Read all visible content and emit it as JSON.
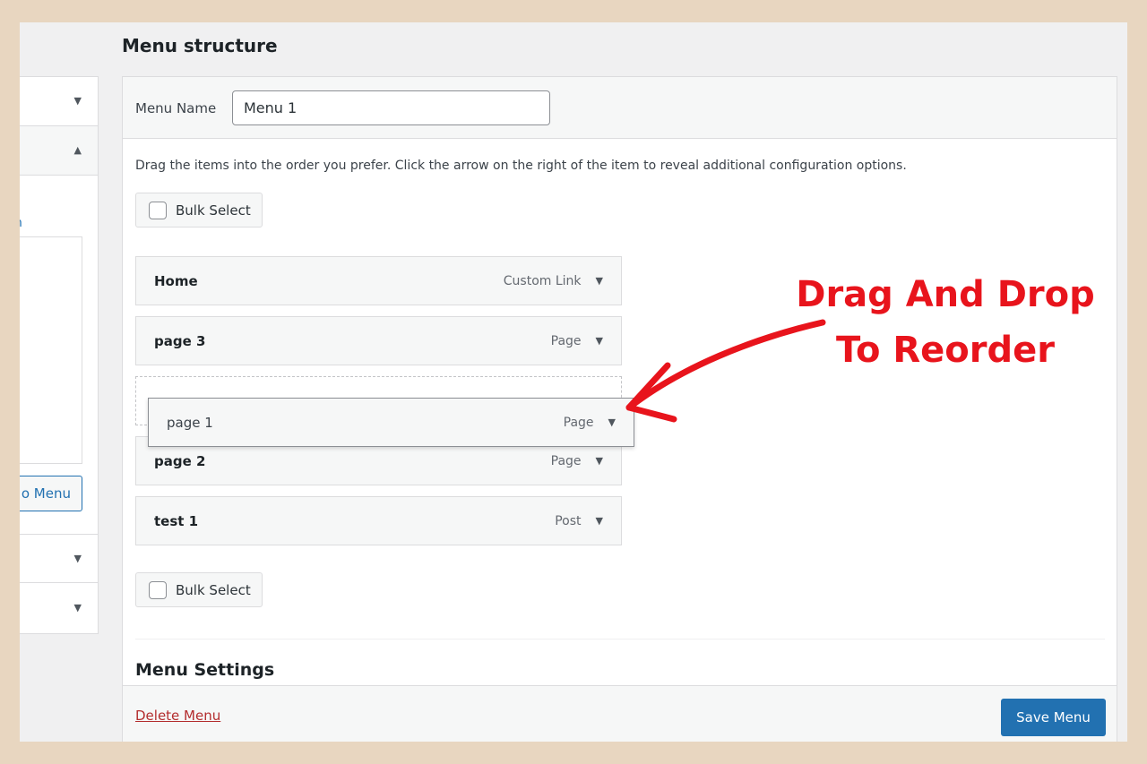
{
  "section_title": "Menu structure",
  "left_panel": {
    "link_fragment": "n",
    "add_button": "o Menu"
  },
  "menu_name": {
    "label": "Menu Name",
    "value": "Menu 1"
  },
  "instructions": "Drag the items into the order you prefer. Click the arrow on the right of the item to reveal additional configuration options.",
  "bulk_select": "Bulk Select",
  "items": [
    {
      "title": "Home",
      "type": "Custom Link"
    },
    {
      "title": "page 3",
      "type": "Page"
    },
    {
      "title": "page 1",
      "type": "Page"
    },
    {
      "title": "page 2",
      "type": "Page"
    },
    {
      "title": "test 1",
      "type": "Post"
    }
  ],
  "menu_settings": "Menu Settings",
  "delete_menu": "Delete Menu",
  "save_menu": "Save Menu",
  "annotation": {
    "line1": "Drag And Drop",
    "line2": "To Reorder",
    "color": "#e8141c"
  },
  "colors": {
    "primary": "#2271b1",
    "delete": "#b32d2e"
  }
}
